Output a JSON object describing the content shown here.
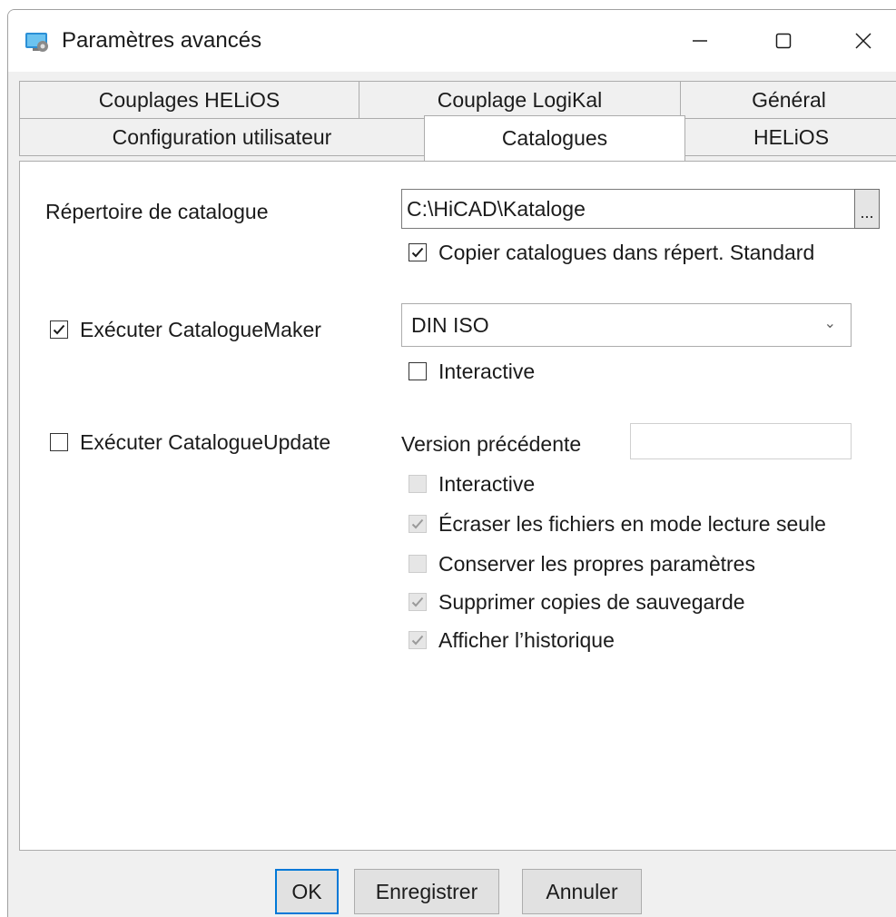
{
  "window": {
    "title": "Paramètres avancés",
    "controls": {
      "minimize": "minimize-icon",
      "maximize": "maximize-icon",
      "close": "close-icon"
    }
  },
  "tabs": {
    "row1": [
      "Couplages HELiOS",
      "Couplage LogiKal",
      "Général"
    ],
    "row2": [
      "Configuration utilisateur",
      "Catalogues",
      "HELiOS"
    ],
    "active": "Catalogues"
  },
  "catalogues": {
    "dir_label": "Répertoire de catalogue",
    "dir_value": "C:\\HiCAD\\Kataloge",
    "browse_label": "...",
    "copy_std": {
      "label": "Copier catalogues dans répert. Standard",
      "checked": true
    },
    "maker": {
      "label": "Exécuter CatalogueMaker",
      "checked": true,
      "selected": "DIN ISO",
      "interactive": {
        "label": "Interactive",
        "checked": false
      }
    },
    "update": {
      "label": "Exécuter CatalogueUpdate",
      "checked": false,
      "prev_version_label": "Version précédente",
      "prev_version_value": "",
      "options": [
        {
          "label": "Interactive",
          "checked": false,
          "enabled": false
        },
        {
          "label": "Écraser les fichiers en mode lecture seule",
          "checked": true,
          "enabled": false
        },
        {
          "label": "Conserver les propres paramètres",
          "checked": false,
          "enabled": false
        },
        {
          "label": "Supprimer copies de sauvegarde",
          "checked": true,
          "enabled": false
        },
        {
          "label": "Afficher l’historique",
          "checked": true,
          "enabled": false
        }
      ]
    }
  },
  "buttons": {
    "ok": "OK",
    "save": "Enregistrer",
    "cancel": "Annuler"
  },
  "colors": {
    "accent": "#0078d7",
    "check_disabled": "#9a9a9a",
    "dialog_bg": "#f0f0f0"
  }
}
